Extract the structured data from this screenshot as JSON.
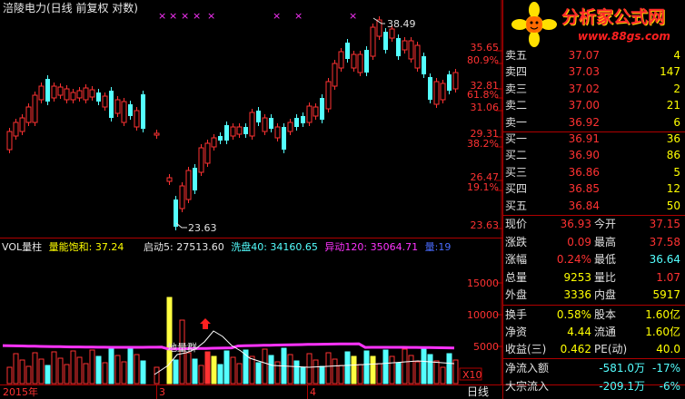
{
  "header": {
    "stock_title": "涪陵电力(日线 前复权 对数)"
  },
  "main_chart": {
    "y_ticks": [
      "35.65",
      "80.9%",
      "32.81",
      "61.8%",
      "31.06",
      "29.31",
      "38.2%",
      "26.47",
      "19.1%",
      "23.63"
    ],
    "high_label": "38.49",
    "low_label": "23.63",
    "x_markers": 8
  },
  "vol_indicator": {
    "name": "VOL量柱",
    "sat_label": "量能饱和:",
    "sat_value": "37.24",
    "qd_label": "启动5:",
    "qd_value": "27513.60",
    "xp_label": "洗盘40:",
    "xp_value": "34160.65",
    "yd_label": "异动120:",
    "yd_value": "35064.71",
    "liang_label": "量:",
    "liang_value": "19",
    "y_ticks": [
      "15000",
      "10000",
      "5000"
    ],
    "unit": "X10",
    "annotation": "地量群"
  },
  "bottom_bar": {
    "year": "2015年",
    "month_a": "3",
    "month_b": "4",
    "period": "日线"
  },
  "watermark": {
    "brand": "分析家公式网",
    "url": "www.88gs.com"
  },
  "order_book": {
    "asks": [
      {
        "label": "卖五",
        "price": "37.07",
        "vol": "4"
      },
      {
        "label": "卖四",
        "price": "37.03",
        "vol": "147"
      },
      {
        "label": "卖三",
        "price": "37.02",
        "vol": "2"
      },
      {
        "label": "卖二",
        "price": "37.00",
        "vol": "21"
      },
      {
        "label": "卖一",
        "price": "36.92",
        "vol": "6"
      }
    ],
    "bids": [
      {
        "label": "买一",
        "price": "36.91",
        "vol": "36"
      },
      {
        "label": "买二",
        "price": "36.90",
        "vol": "86"
      },
      {
        "label": "买三",
        "price": "36.86",
        "vol": "5"
      },
      {
        "label": "买四",
        "price": "36.85",
        "vol": "12"
      },
      {
        "label": "买五",
        "price": "36.84",
        "vol": "50"
      }
    ]
  },
  "quote": {
    "rows": [
      {
        "l1": "现价",
        "v1": "36.93",
        "l2": "今开",
        "v2": "37.15"
      },
      {
        "l1": "涨跌",
        "v1": "0.09",
        "l2": "最高",
        "v2": "37.58"
      },
      {
        "l1": "涨幅",
        "v1": "0.24%",
        "l2": "最低",
        "v2": "36.64"
      },
      {
        "l1": "总量",
        "v1": "9253",
        "l2": "量比",
        "v2": "1.07"
      },
      {
        "l1": "外盘",
        "v1": "3336",
        "l2": "内盘",
        "v2": "5917"
      }
    ],
    "rows2": [
      {
        "l1": "换手",
        "v1": "0.58%",
        "l2": "股本",
        "v2": "1.60亿"
      },
      {
        "l1": "净资",
        "v1": "4.44",
        "l2": "流通",
        "v2": "1.60亿"
      },
      {
        "l1": "收益(三)",
        "v1": "0.462",
        "l2": "PE(动)",
        "v2": "40.0"
      }
    ],
    "flow": [
      {
        "label": "净流入额",
        "value": "-581.0万",
        "pct": "-17%"
      },
      {
        "label": "大宗流入",
        "value": "-209.1万",
        "pct": "-6%"
      }
    ]
  },
  "colors": {
    "up": "#ff3232",
    "down": "#54ffff",
    "grid": "#b00000",
    "ma": "#ff33ff"
  }
}
